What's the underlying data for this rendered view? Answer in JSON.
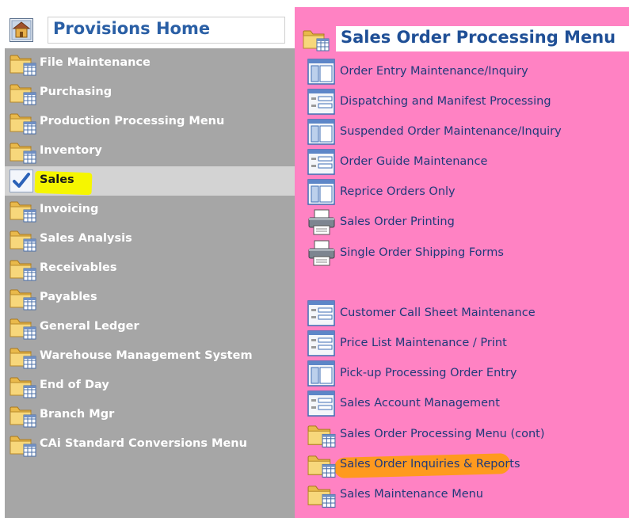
{
  "left_panel": {
    "title": "Provisions Home",
    "home_icon": "home-icon",
    "items": [
      {
        "label": "File Maintenance",
        "icon": "folder-icon"
      },
      {
        "label": "Purchasing",
        "icon": "folder-icon"
      },
      {
        "label": "Production Processing Menu",
        "icon": "folder-icon"
      },
      {
        "label": "Inventory",
        "icon": "folder-icon"
      },
      {
        "label": "Sales",
        "icon": "checkmark-icon",
        "selected": true
      },
      {
        "label": "Invoicing",
        "icon": "folder-icon"
      },
      {
        "label": "Sales Analysis",
        "icon": "folder-icon"
      },
      {
        "label": "Receivables",
        "icon": "folder-icon"
      },
      {
        "label": "Payables",
        "icon": "folder-icon"
      },
      {
        "label": "General Ledger",
        "icon": "folder-icon"
      },
      {
        "label": "Warehouse Management System",
        "icon": "folder-icon"
      },
      {
        "label": "End of Day",
        "icon": "folder-icon"
      },
      {
        "label": "Branch Mgr",
        "icon": "folder-icon"
      },
      {
        "label": "CAi Standard Conversions Menu",
        "icon": "folder-icon"
      }
    ]
  },
  "right_panel": {
    "title": "Sales Order Processing Menu",
    "items": [
      {
        "label": "Order Entry Maintenance/Inquiry",
        "icon": "form-split-icon"
      },
      {
        "label": "Dispatching and Manifest Processing",
        "icon": "form-list-icon"
      },
      {
        "label": "Suspended Order Maintenance/Inquiry",
        "icon": "form-split-icon"
      },
      {
        "label": "Order Guide Maintenance",
        "icon": "form-list-icon"
      },
      {
        "label": "Reprice Orders Only",
        "icon": "form-split-icon"
      },
      {
        "label": "Sales Order Printing",
        "icon": "printer-icon"
      },
      {
        "label": "Single Order Shipping Forms",
        "icon": "printer-icon"
      },
      {
        "label": "Customer Call Sheet Maintenance",
        "icon": "form-list-icon"
      },
      {
        "label": "Price List Maintenance / Print",
        "icon": "form-list-icon"
      },
      {
        "label": "Pick-up Processing Order Entry",
        "icon": "form-split-icon"
      },
      {
        "label": "Sales Account Management",
        "icon": "form-list-icon"
      },
      {
        "label": "Sales Order Processing Menu (cont)",
        "icon": "folder-icon"
      },
      {
        "label": "Sales Order Inquiries & Reports",
        "icon": "folder-icon",
        "highlighted": true
      },
      {
        "label": "Sales Maintenance Menu",
        "icon": "folder-icon"
      }
    ]
  },
  "colors": {
    "left_bg": "#a6a6a6",
    "right_bg": "#ff82c3",
    "title_blue": "#2a5fa5",
    "selected_highlight": "#f6f600",
    "annotation_highlight": "#ff9a1e"
  }
}
